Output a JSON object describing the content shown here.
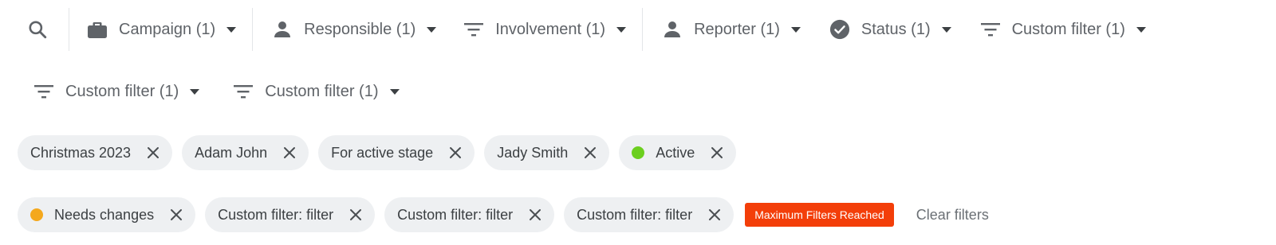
{
  "colors": {
    "icon": "#5f6368",
    "chip_bg": "#eef0f2",
    "active_dot": "#6ccf1f",
    "needs_changes_dot": "#f4a81d",
    "badge_bg": "#f33e09"
  },
  "toolbar": {
    "search_icon": "search-icon",
    "filters": [
      {
        "label": "Campaign (1)",
        "icon": "briefcase-icon"
      },
      {
        "label": "Responsible (1)",
        "icon": "person-icon"
      },
      {
        "label": "Involvement (1)",
        "icon": "filter-lines-icon"
      },
      {
        "label": "Reporter (1)",
        "icon": "person-icon"
      },
      {
        "label": "Status (1)",
        "icon": "check-circle-icon"
      },
      {
        "label": "Custom filter (1)",
        "icon": "filter-lines-icon"
      },
      {
        "label": "Custom filter (1)",
        "icon": "filter-lines-icon"
      },
      {
        "label": "Custom filter (1)",
        "icon": "filter-lines-icon"
      }
    ]
  },
  "chips": {
    "row1": [
      {
        "label": "Christmas 2023"
      },
      {
        "label": "Adam John"
      },
      {
        "label": "For active stage"
      },
      {
        "label": "Jady Smith"
      },
      {
        "label": "Active",
        "dot": "active"
      }
    ],
    "row2": [
      {
        "label": "Needs changes",
        "dot": "needs_changes"
      },
      {
        "label": "Custom filter: filter"
      },
      {
        "label": "Custom filter: filter"
      },
      {
        "label": "Custom filter: filter"
      }
    ]
  },
  "badge": {
    "label": "Maximum Filters Reached"
  },
  "clear_filters": {
    "label": "Clear filters"
  }
}
